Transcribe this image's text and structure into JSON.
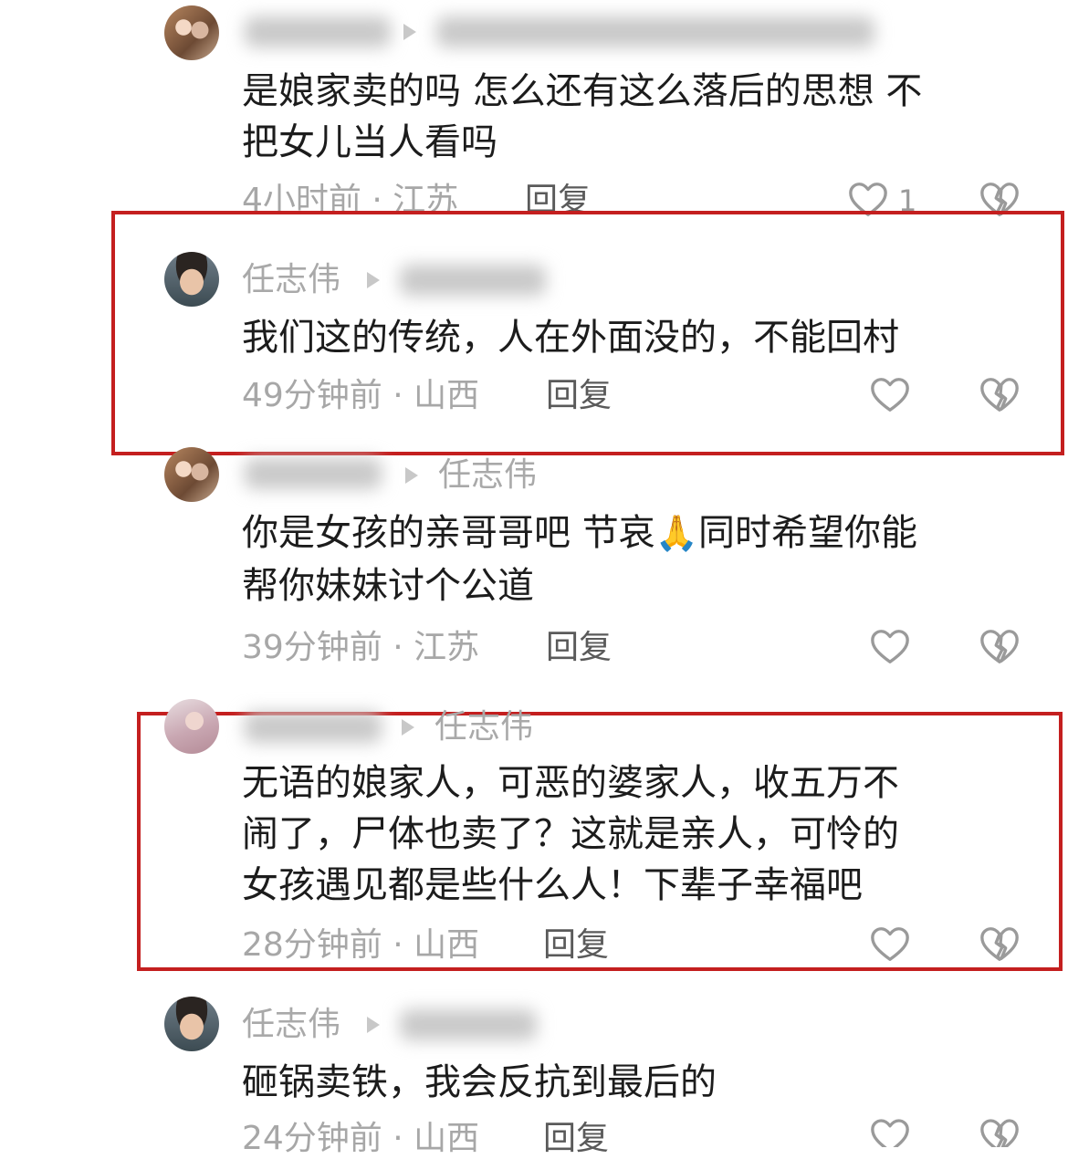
{
  "comments": [
    {
      "name": "",
      "target": "",
      "lines": [
        "是娘家卖的吗 怎么还有这么落后的思想 不",
        "把女儿当人看吗"
      ],
      "meta": "4小时前 · 江苏",
      "reply": "回复",
      "likes": "1"
    },
    {
      "name": "任志伟",
      "target": "",
      "lines": [
        "我们这的传统，人在外面没的，不能回村"
      ],
      "meta": "49分钟前 · 山西",
      "reply": "回复",
      "likes": ""
    },
    {
      "name": "",
      "target": "任志伟",
      "lines_a": "你是女孩的亲哥哥吧 节哀",
      "emoji": "🙏",
      "lines_b": "同时希望你能",
      "lines": [
        "帮你妹妹讨个公道"
      ],
      "meta": "39分钟前 · 江苏",
      "reply": "回复",
      "likes": ""
    },
    {
      "name": "",
      "target": "任志伟",
      "lines": [
        "无语的娘家人，可恶的婆家人，收五万不",
        "闹了，尸体也卖了？这就是亲人，可怜的",
        "女孩遇见都是些什么人！下辈子幸福吧"
      ],
      "meta": "28分钟前 · 山西",
      "reply": "回复",
      "likes": ""
    },
    {
      "name": "任志伟",
      "target": "",
      "lines": [
        "砸锅卖铁，我会反抗到最后的"
      ],
      "meta": "24分钟前 · 山西",
      "reply": "回复",
      "likes": ""
    }
  ],
  "icons": {
    "like": "heart-outline-icon",
    "dislike": "broken-heart-icon",
    "arrow": "reply-arrow-icon"
  },
  "colors": {
    "highlight": "#c41f1f",
    "meta": "#a7a7a7",
    "text": "#1c1c1c"
  }
}
